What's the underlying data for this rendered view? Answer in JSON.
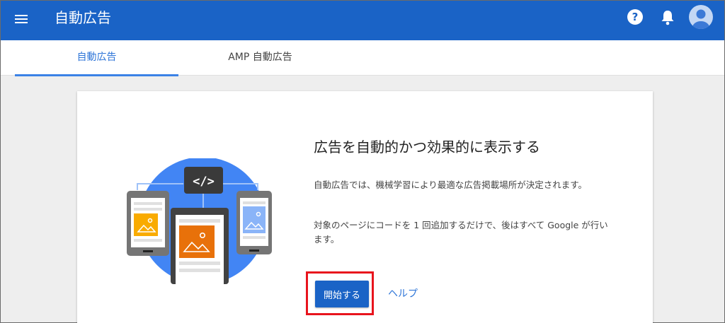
{
  "app": {
    "title": "自動広告"
  },
  "header": {
    "menu_icon": "menu-icon",
    "help_icon": "help-icon",
    "notification_icon": "bell-icon",
    "avatar_icon": "account-avatar-icon",
    "help_glyph": "?"
  },
  "tabs": [
    {
      "label": "自動広告",
      "active": true
    },
    {
      "label": "AMP 自動広告",
      "active": false
    }
  ],
  "card": {
    "headline": "広告を自動的かつ効果的に表示する",
    "paragraph1": "自動広告では、機械学習により最適な広告掲載場所が決定されます。",
    "paragraph2": "対象のページにコードを 1 回追加するだけで、後はすべて Google が行います。",
    "code_badge": "</>",
    "start_button": "開始する",
    "help_link": "ヘルプ"
  },
  "colors": {
    "appbar": "#1a63c6",
    "accent": "#2f76d8",
    "highlight": "#e8141d"
  }
}
